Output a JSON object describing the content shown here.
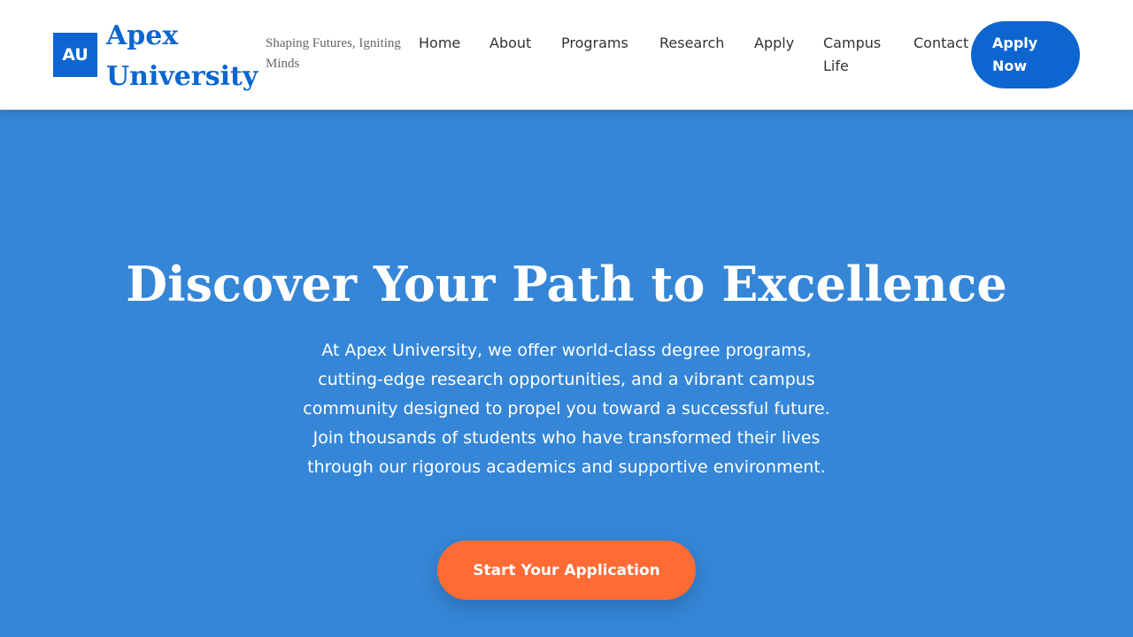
{
  "header": {
    "logo_initials": "AU",
    "brand_name": "Apex University",
    "tagline": "Shaping Futures, Igniting Minds",
    "nav": {
      "home": "Home",
      "about": "About",
      "programs": "Programs",
      "research": "Research",
      "apply": "Apply",
      "campus_life": "Campus Life",
      "contact": "Contact"
    },
    "apply_button": "Apply Now"
  },
  "hero": {
    "title": "Discover Your Path to Excellence",
    "description": "At Apex University, we offer world-class degree programs, cutting-edge research opportunities, and a vibrant campus community designed to propel you toward a successful future. Join thousands of students who have transformed their lives through our rigorous academics and supportive environment.",
    "cta_label": "Start Your Application"
  },
  "colors": {
    "brand_blue": "#0d66d0",
    "hero_background": "#3586d7",
    "cta_orange": "#ff6b35",
    "header_background": "#ffffff"
  }
}
